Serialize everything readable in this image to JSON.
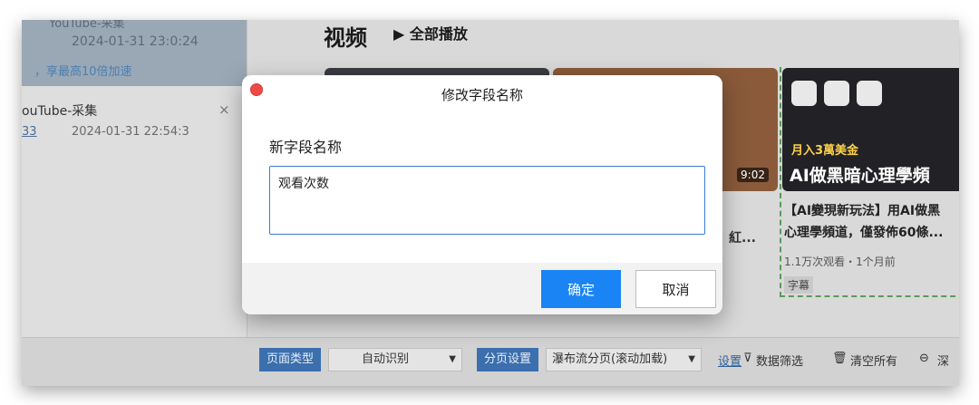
{
  "sidebar": {
    "top_truncated": "YouTube-采集",
    "top_date": "2024-01-31 23:0:24",
    "speed_text": "，享最高10倍加速",
    "item_title": "ouTube-采集",
    "item_close": "×",
    "item_number": "33",
    "item_date": "2024-01-31 22:54:3"
  },
  "main": {
    "title": "视频",
    "play_all": "▶ 全部播放",
    "thumb2_duration": "9:02",
    "mid_text": "紅...",
    "video3": {
      "promo": "月入3萬美金",
      "overlay_title": "AI做黑暗心理學頻",
      "title_line1": "【AI變現新玩法】用AI做黑",
      "title_line2": "心理學頻道，僅發佈60條...",
      "meta": "1.1万次观看・1个月前",
      "tag": "字幕"
    }
  },
  "toolbar": {
    "page_type_label": "页面类型",
    "page_type_value": "自动识别",
    "paging_label": "分页设置",
    "paging_value": "瀑布流分页(滚动加载)",
    "setting_link": "设置",
    "filter_text": "数据筛选",
    "clear_text": "清空所有",
    "deep_text": "深"
  },
  "dialog": {
    "title": "修改字段名称",
    "field_label": "新字段名称",
    "field_value": "观看次数",
    "ok_label": "确定",
    "cancel_label": "取消"
  }
}
